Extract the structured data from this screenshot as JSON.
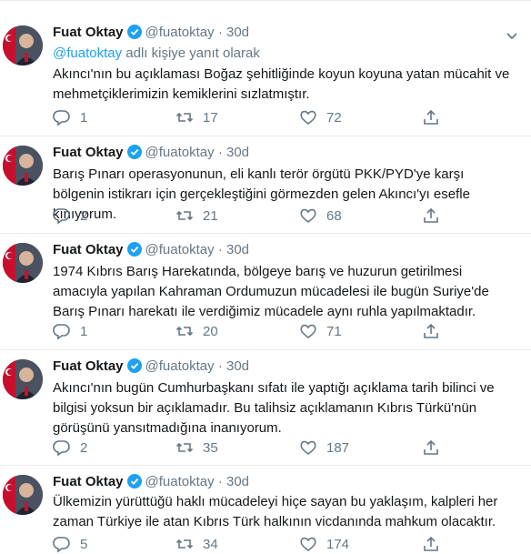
{
  "tweets": [
    {
      "name": "Fuat Oktay",
      "handle": "@fuatoktay",
      "dot": "·",
      "time": "30d",
      "reply_to": {
        "handle": "@fuatoktay",
        "suffix": " adlı kişiye yanıt olarak"
      },
      "text": "Akıncı'nın bu açıklaması Boğaz şehitliğinde koyun koyuna yatan mücahit ve mehmetçiklerimizin kemiklerini sızlatmıştır.",
      "replies": "1",
      "retweets": "17",
      "likes": "72"
    },
    {
      "name": "Fuat Oktay",
      "handle": "@fuatoktay",
      "dot": "·",
      "time": "30d",
      "text": "Barış Pınarı operasyonunun, eli kanlı terör örgütü PKK/PYD'ye karşı bölgenin istikrarı için gerçekleştiğini görmezden gelen Akıncı'yı esefle kınıyorum.",
      "replies": "2",
      "retweets": "21",
      "likes": "68"
    },
    {
      "name": "Fuat Oktay",
      "handle": "@fuatoktay",
      "dot": "·",
      "time": "30d",
      "text": "1974 Kıbrıs Barış Harekatında, bölgeye barış ve huzurun getirilmesi amacıyla yapılan Kahraman Ordumuzun mücadelesi ile bugün Suriye'de Barış Pınarı harekatı ile verdiğimiz mücadele aynı ruhla yapılmaktadır.",
      "replies": "1",
      "retweets": "20",
      "likes": "71"
    },
    {
      "name": "Fuat Oktay",
      "handle": "@fuatoktay",
      "dot": "·",
      "time": "30d",
      "text": "Akıncı'nın bugün Cumhurbaşkanı sıfatı ile yaptığı açıklama tarih bilinci ve bilgisi yoksun bir açıklamadır. Bu talihsiz açıklamanın Kıbrıs Türkü'nün görüşünü yansıtmadığına inanıyorum.",
      "replies": "2",
      "retweets": "35",
      "likes": "187"
    },
    {
      "name": "Fuat Oktay",
      "handle": "@fuatoktay",
      "dot": "·",
      "time": "30d",
      "text": "Ülkemizin yürüttüğü haklı mücadeleyi hiçe sayan bu yaklaşım, kalpleri her zaman Türkiye ile atan Kıbrıs Türk halkının vicdanında mahkum olacaktır.",
      "replies": "5",
      "retweets": "34",
      "likes": "174"
    }
  ],
  "colors": {
    "accent": "#1da1f2",
    "muted": "#657786",
    "text": "#14171a",
    "divider": "#e6ecf0"
  },
  "icons": [
    "verified-badge-icon",
    "caret-down-icon",
    "reply-icon",
    "retweet-icon",
    "like-icon",
    "share-icon"
  ]
}
